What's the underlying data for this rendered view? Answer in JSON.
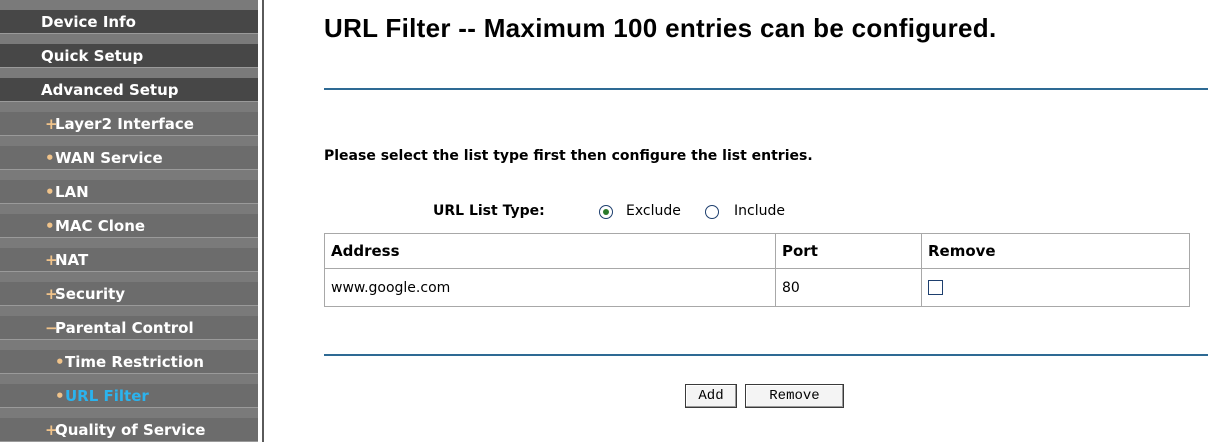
{
  "sidebar": {
    "items": [
      {
        "label": "Device Info",
        "mark": ""
      },
      {
        "label": "Quick Setup",
        "mark": ""
      },
      {
        "label": "Advanced Setup",
        "mark": ""
      },
      {
        "label": "Layer2 Interface",
        "mark": "+"
      },
      {
        "label": "WAN Service",
        "mark": "•"
      },
      {
        "label": "LAN",
        "mark": "•"
      },
      {
        "label": "MAC Clone",
        "mark": "•"
      },
      {
        "label": "NAT",
        "mark": "+"
      },
      {
        "label": "Security",
        "mark": "+"
      },
      {
        "label": "Parental Control",
        "mark": "−"
      },
      {
        "label": "Time Restriction",
        "mark": "•"
      },
      {
        "label": "URL Filter",
        "mark": "•"
      },
      {
        "label": "Quality of Service",
        "mark": "+"
      }
    ],
    "active_color": "#2bb3ee"
  },
  "main": {
    "title": "URL Filter -- Maximum 100 entries can be configured.",
    "instruction": "Please select the list type first then configure the list entries.",
    "list_type": {
      "label": "URL List Type:",
      "options": [
        "Exclude",
        "Include"
      ],
      "selected": "Exclude"
    },
    "table": {
      "headers": [
        "Address",
        "Port",
        "Remove"
      ],
      "rows": [
        {
          "address": "www.google.com",
          "port": "80",
          "remove": false
        }
      ]
    },
    "buttons": {
      "add": "Add",
      "remove": "Remove"
    }
  }
}
